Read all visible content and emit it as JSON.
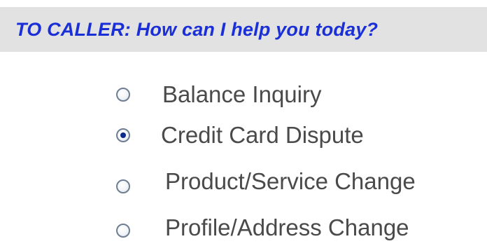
{
  "prompt": {
    "text": "TO CALLER:  How can I help you today?"
  },
  "options": [
    {
      "label": "Balance Inquiry",
      "selected": false
    },
    {
      "label": "Credit Card Dispute",
      "selected": true
    },
    {
      "label": "Product/Service Change",
      "selected": false
    },
    {
      "label": "Profile/Address Change",
      "selected": false
    }
  ],
  "colors": {
    "prompt_text": "#1a2fd6",
    "prompt_bar": "#e2e2e2",
    "label_text": "#4a4a4a",
    "radio_dot": "#0c2a8c"
  }
}
